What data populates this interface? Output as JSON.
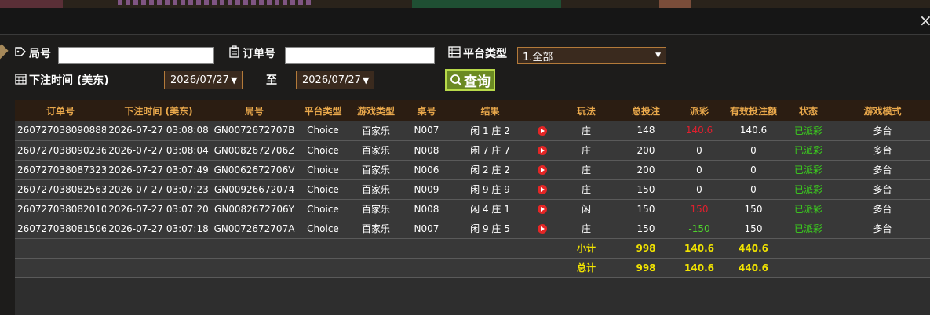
{
  "filters": {
    "round_label": "局号",
    "round_value": "",
    "order_label": "订单号",
    "order_value": "",
    "platform_label": "平台类型",
    "platform_value": "1.全部",
    "time_label": "下注时间 (美东)",
    "date_from": "2026/07/27",
    "to_label": "至",
    "date_to": "2026/07/27",
    "query_label": "查询"
  },
  "table": {
    "headers": [
      "订单号",
      "下注时间 (美东)",
      "局号",
      "平台类型",
      "游戏类型",
      "桌号",
      "结果",
      "",
      "玩法",
      "总投注",
      "派彩",
      "有效投注额",
      "状态",
      "游戏模式"
    ],
    "rows": [
      {
        "order": "260727038090888",
        "time": "2026-07-27 03:08:08",
        "round": "GN0072672707B",
        "platform": "Choice",
        "game": "百家乐",
        "table": "N007",
        "result": "闲 1 庄 2",
        "play": "庄",
        "bet": "148",
        "payout": "140.6",
        "payout_color": "red",
        "valid": "140.6",
        "status": "已派彩",
        "mode": "多台"
      },
      {
        "order": "260727038090236",
        "time": "2026-07-27 03:08:04",
        "round": "GN0082672706Z",
        "platform": "Choice",
        "game": "百家乐",
        "table": "N008",
        "result": "闲 7 庄 7",
        "play": "庄",
        "bet": "200",
        "payout": "0",
        "payout_color": "white",
        "valid": "0",
        "status": "已派彩",
        "mode": "多台"
      },
      {
        "order": "260727038087323",
        "time": "2026-07-27 03:07:49",
        "round": "GN0062672706V",
        "platform": "Choice",
        "game": "百家乐",
        "table": "N006",
        "result": "闲 2 庄 2",
        "play": "庄",
        "bet": "200",
        "payout": "0",
        "payout_color": "white",
        "valid": "0",
        "status": "已派彩",
        "mode": "多台"
      },
      {
        "order": "260727038082563",
        "time": "2026-07-27 03:07:23",
        "round": "GN00926672074",
        "platform": "Choice",
        "game": "百家乐",
        "table": "N009",
        "result": "闲 9 庄 9",
        "play": "庄",
        "bet": "150",
        "payout": "0",
        "payout_color": "white",
        "valid": "0",
        "status": "已派彩",
        "mode": "多台"
      },
      {
        "order": "260727038082010",
        "time": "2026-07-27 03:07:20",
        "round": "GN0082672706Y",
        "platform": "Choice",
        "game": "百家乐",
        "table": "N008",
        "result": "闲 4 庄 1",
        "play": "闲",
        "bet": "150",
        "payout": "150",
        "payout_color": "red",
        "valid": "150",
        "status": "已派彩",
        "mode": "多台"
      },
      {
        "order": "260727038081506",
        "time": "2026-07-27 03:07:18",
        "round": "GN0072672707A",
        "platform": "Choice",
        "game": "百家乐",
        "table": "N007",
        "result": "闲 9 庄 5",
        "play": "庄",
        "bet": "150",
        "payout": "-150",
        "payout_color": "green",
        "valid": "150",
        "status": "已派彩",
        "mode": "多台"
      }
    ],
    "subtotal": {
      "label": "小计",
      "bet": "998",
      "payout": "140.6",
      "valid": "440.6"
    },
    "total": {
      "label": "总计",
      "bet": "998",
      "payout": "140.6",
      "valid": "440.6"
    }
  },
  "close_label": "×",
  "colors": {
    "header_text": "#e9a84b",
    "sum_text": "#f2e400",
    "paid": "#3bd11d",
    "payout_red": "#e0202e",
    "payout_green": "#4fd22d",
    "query_btn": "#6b8a23"
  }
}
